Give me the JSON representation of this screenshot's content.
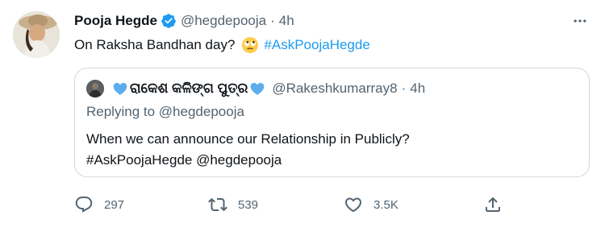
{
  "author": {
    "name": "Pooja Hegde",
    "handle": "@hegdepooja",
    "separator": "·",
    "time": "4h",
    "avatar_icon": "profile-photo",
    "verified_icon": "verified-badge-icon"
  },
  "tweet": {
    "text": "On Raksha Bandhan day?",
    "emoji": "face-with-rolling-eyes",
    "hashtag": "#AskPoojaHegde"
  },
  "quote": {
    "name_prefix_heart": "blue-heart",
    "name": "ରାକେଶ କଳିଙ୍ଗ ପୁତ୍ର",
    "name_suffix_heart": "blue-heart",
    "handle": "@Rakeshkumarray8",
    "separator": "·",
    "time": "4h",
    "replying_label": "Replying to",
    "replying_to": "@hegdepooja",
    "text_line1": "When we can announce our Relationship in Publicly?",
    "text_line2": "#AskPoojaHegde @hegdepooja"
  },
  "actions": {
    "reply_count": "297",
    "retweet_count": "539",
    "like_count": "3.5K"
  },
  "colors": {
    "text": "#0f1419",
    "secondary": "#536471",
    "accent": "#1d9bf0",
    "border": "#cfd9de",
    "heart": "#5dadec"
  }
}
